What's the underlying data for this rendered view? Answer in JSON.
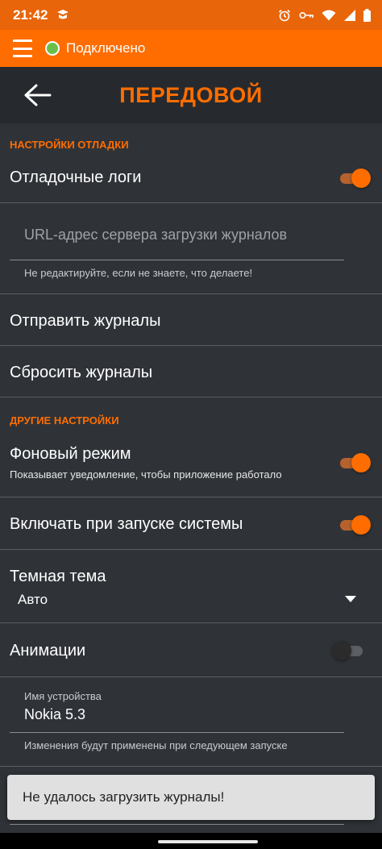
{
  "status_bar": {
    "time": "21:42",
    "icons": [
      "app-notification-icon",
      "alarm-icon",
      "vpn-key-icon",
      "wifi-icon",
      "signal-icon",
      "battery-icon"
    ]
  },
  "app_bar": {
    "connection_status": "Подключено",
    "connection_color": "#6cc04a",
    "accent": "#ff6d00"
  },
  "header": {
    "title": "ПЕРЕДОВОЙ"
  },
  "debug_section": {
    "label": "НАСТРОЙКИ ОТЛАДКИ",
    "debug_logs": {
      "title": "Отладочные логи",
      "enabled": true
    },
    "log_url": {
      "placeholder": "URL-адрес сервера загрузки журналов",
      "value": "",
      "help": "Не редактируйте, если не знаете, что делаете!"
    },
    "send_logs": "Отправить журналы",
    "reset_logs": "Сбросить журналы"
  },
  "other_section": {
    "label": "ДРУГИЕ НАСТРОЙКИ",
    "background_mode": {
      "title": "Фоновый режим",
      "subtitle": "Показывает уведомление, чтобы приложение работало",
      "enabled": true
    },
    "start_on_boot": {
      "title": "Включать при запуске системы",
      "enabled": true
    },
    "dark_theme": {
      "title": "Темная тема",
      "selected": "Авто"
    },
    "animations": {
      "title": "Анимации",
      "enabled": false
    },
    "device_name": {
      "label": "Имя устройства",
      "value": "Nokia 5.3",
      "help": "Изменения будут применены при следующем запуске"
    }
  },
  "snackbar": {
    "message": "Не удалось загрузить журналы!"
  }
}
